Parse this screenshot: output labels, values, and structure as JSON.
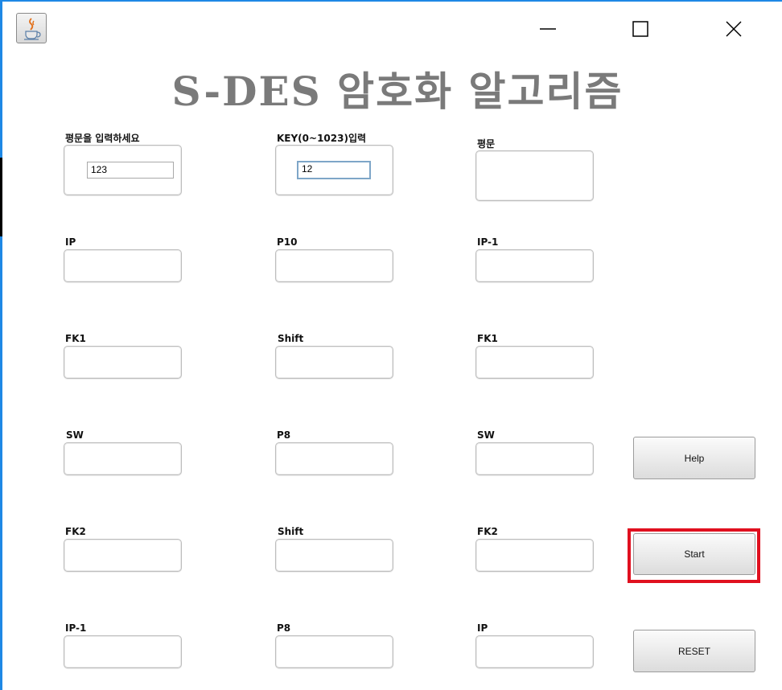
{
  "window": {
    "title": "S-DES 암호화 알고리즘",
    "controls": [
      "minimize",
      "maximize",
      "close"
    ]
  },
  "inputs": {
    "plaintext": {
      "label": "평문을 입력하세요",
      "value": "123"
    },
    "key": {
      "label": "KEY(0~1023)입력",
      "value": "12"
    }
  },
  "fields": {
    "plain_out": "평문",
    "col1": [
      "IP",
      "FK1",
      "SW",
      "FK2",
      "IP-1"
    ],
    "col2": [
      "P10",
      "Shift",
      "P8",
      "Shift",
      "P8"
    ],
    "col3": [
      "IP-1",
      "FK1",
      "SW",
      "FK2",
      "IP"
    ]
  },
  "buttons": {
    "help": "Help",
    "start": "Start",
    "reset": "RESET"
  },
  "colors": {
    "title": "#7a7a7a",
    "highlight": "#e0101f",
    "accent": "#1e88e5"
  }
}
